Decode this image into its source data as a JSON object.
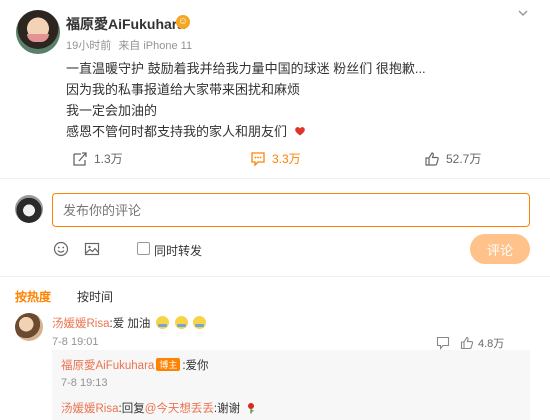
{
  "post": {
    "author": "福原愛AiFukuhara",
    "time": "19小时前",
    "source": "来自 iPhone 11",
    "lines": [
      "一直温暖守护 鼓励着我并给我力量中国的球迷 粉丝们 很抱歉...",
      "因为我的私事报道给大家带来困扰和麻烦",
      "我一定会加油的",
      "感恩不管何时都支持我的家人和朋友们"
    ],
    "actions": {
      "share": "1.3万",
      "comment": "3.3万",
      "like": "52.7万"
    }
  },
  "comment_box": {
    "placeholder": "发布你的评论",
    "repost_label": "同时转发",
    "submit_label": "评论"
  },
  "tabs": {
    "hot": "按热度",
    "time": "按时间"
  },
  "comments": [
    {
      "user": "汤媛媛Risa",
      "text": ":爱 加油",
      "time": "7-8 19:01",
      "likes": "4.8万",
      "replies": [
        {
          "user": "福原愛AiFukuhara",
          "badge": "博主",
          "text": ":爱你",
          "time": "7-8 19:13"
        },
        {
          "user": "汤媛媛Risa",
          "text_prefix": ":回复",
          "mention": "@今天想丢丢",
          "text_suffix": ":谢谢"
        }
      ]
    }
  ],
  "colors": {
    "accent": "#ff8200",
    "username": "#eb7350",
    "mention": "#eb7350"
  }
}
